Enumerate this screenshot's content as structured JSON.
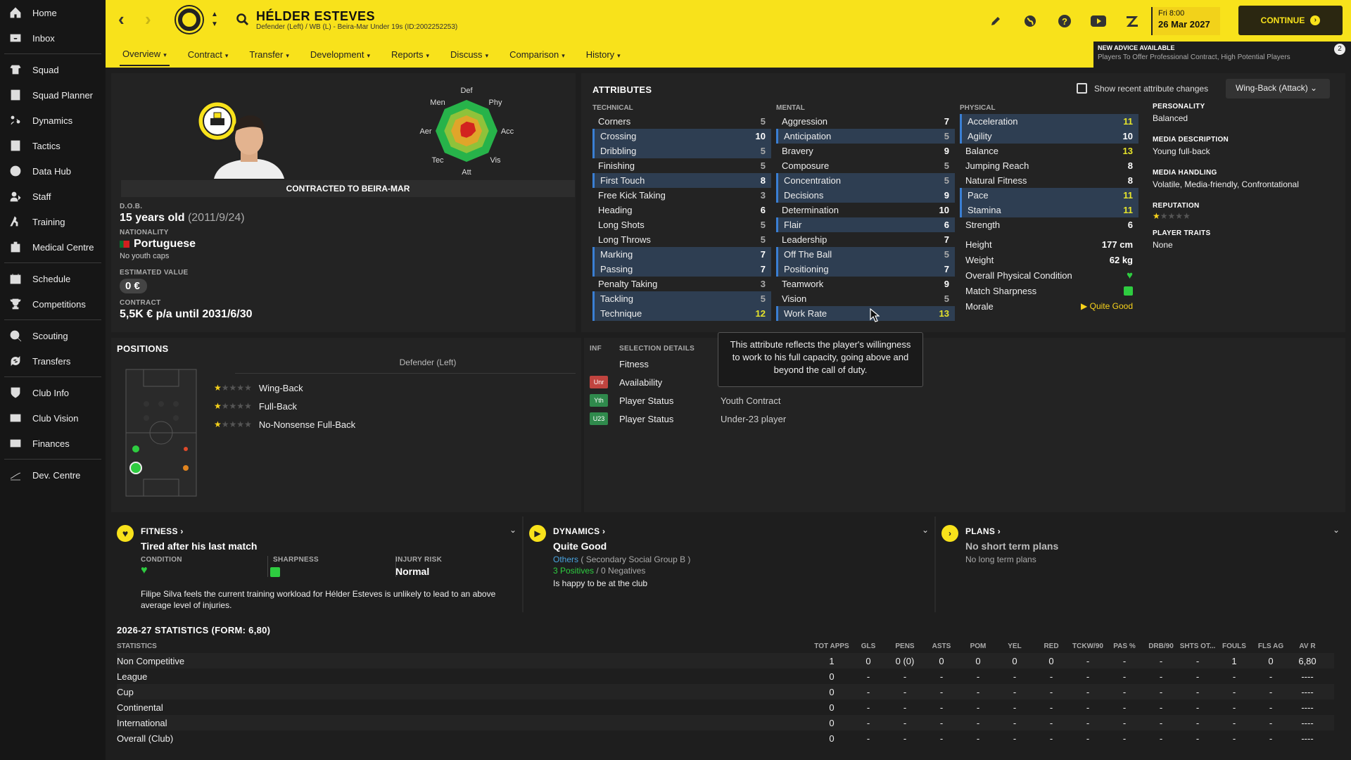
{
  "sidebar": {
    "items": [
      {
        "label": "Home",
        "icon": "home-icon"
      },
      {
        "label": "Inbox",
        "icon": "inbox-icon"
      },
      {
        "label": "Squad",
        "icon": "squad-icon"
      },
      {
        "label": "Squad Planner",
        "icon": "squad-planner-icon"
      },
      {
        "label": "Dynamics",
        "icon": "dynamics-icon"
      },
      {
        "label": "Tactics",
        "icon": "tactics-icon"
      },
      {
        "label": "Data Hub",
        "icon": "data-hub-icon"
      },
      {
        "label": "Staff",
        "icon": "staff-icon"
      },
      {
        "label": "Training",
        "icon": "training-icon"
      },
      {
        "label": "Medical Centre",
        "icon": "medical-icon"
      },
      {
        "label": "Schedule",
        "icon": "schedule-icon"
      },
      {
        "label": "Competitions",
        "icon": "trophy-icon"
      },
      {
        "label": "Scouting",
        "icon": "scouting-icon"
      },
      {
        "label": "Transfers",
        "icon": "transfers-icon"
      },
      {
        "label": "Club Info",
        "icon": "club-info-icon"
      },
      {
        "label": "Club Vision",
        "icon": "club-vision-icon"
      },
      {
        "label": "Finances",
        "icon": "finances-icon"
      },
      {
        "label": "Dev. Centre",
        "icon": "dev-centre-icon"
      }
    ]
  },
  "header": {
    "player_name": "HÉLDER ESTEVES",
    "player_sub": "Defender (Left) / WB (L) - Beira-Mar Under 19s (ID:2002252253)",
    "date_line1": "Fri 8:00",
    "date_line2": "26 Mar 2027",
    "continue_label": "CONTINUE"
  },
  "tabs": [
    {
      "label": "Overview"
    },
    {
      "label": "Contract"
    },
    {
      "label": "Transfer"
    },
    {
      "label": "Development"
    },
    {
      "label": "Reports"
    },
    {
      "label": "Discuss"
    },
    {
      "label": "Comparison"
    },
    {
      "label": "History"
    }
  ],
  "advice": {
    "title": "NEW ADVICE AVAILABLE",
    "text": "Players To Offer Professional Contract, High Potential Players",
    "count": "2"
  },
  "profile": {
    "contract_banner": "CONTRACTED TO BEIRA-MAR",
    "dob_label": "D.O.B.",
    "age": "15 years old",
    "dob": "(2011/9/24)",
    "nationality_label": "NATIONALITY",
    "nationality": "Portuguese",
    "youth_caps": "No youth caps",
    "value_label": "ESTIMATED VALUE",
    "value": "0 €",
    "contract_label": "CONTRACT",
    "contract": "5,5K € p/a until 2031/6/30"
  },
  "radar": {
    "labels": [
      "Def",
      "Phy",
      "Acc",
      "Vis",
      "Att",
      "Tec",
      "Aer",
      "Men"
    ]
  },
  "attributes": {
    "title": "ATTRIBUTES",
    "show_changes_label": "Show recent attribute changes",
    "role": "Wing-Back (Attack)",
    "technical_label": "TECHNICAL",
    "mental_label": "MENTAL",
    "physical_label": "PHYSICAL",
    "technical": [
      [
        "Corners",
        "5"
      ],
      [
        "Crossing",
        "10"
      ],
      [
        "Dribbling",
        "5"
      ],
      [
        "Finishing",
        "5"
      ],
      [
        "First Touch",
        "8"
      ],
      [
        "Free Kick Taking",
        "3"
      ],
      [
        "Heading",
        "6"
      ],
      [
        "Long Shots",
        "5"
      ],
      [
        "Long Throws",
        "5"
      ],
      [
        "Marking",
        "7"
      ],
      [
        "Passing",
        "7"
      ],
      [
        "Penalty Taking",
        "3"
      ],
      [
        "Tackling",
        "5"
      ],
      [
        "Technique",
        "12"
      ]
    ],
    "mental": [
      [
        "Aggression",
        "7"
      ],
      [
        "Anticipation",
        "5"
      ],
      [
        "Bravery",
        "9"
      ],
      [
        "Composure",
        "5"
      ],
      [
        "Concentration",
        "5"
      ],
      [
        "Decisions",
        "9"
      ],
      [
        "Determination",
        "10"
      ],
      [
        "Flair",
        "6"
      ],
      [
        "Leadership",
        "7"
      ],
      [
        "Off The Ball",
        "5"
      ],
      [
        "Positioning",
        "7"
      ],
      [
        "Teamwork",
        "9"
      ],
      [
        "Vision",
        "5"
      ],
      [
        "Work Rate",
        "13"
      ]
    ],
    "physical": [
      [
        "Acceleration",
        "11"
      ],
      [
        "Agility",
        "10"
      ],
      [
        "Balance",
        "13"
      ],
      [
        "Jumping Reach",
        "8"
      ],
      [
        "Natural Fitness",
        "8"
      ],
      [
        "Pace",
        "11"
      ],
      [
        "Stamina",
        "11"
      ],
      [
        "Strength",
        "6"
      ]
    ],
    "height_label": "Height",
    "height": "177 cm",
    "weight_label": "Weight",
    "weight": "62 kg",
    "condition_label": "Overall Physical Condition",
    "sharpness_label": "Match Sharpness",
    "morale_label": "Morale",
    "morale": "Quite Good"
  },
  "personality": {
    "personality_label": "PERSONALITY",
    "personality": "Balanced",
    "media_desc_label": "MEDIA DESCRIPTION",
    "media_desc": "Young full-back",
    "media_handling_label": "MEDIA HANDLING",
    "media_handling": "Volatile, Media-friendly, Confrontational",
    "reputation_label": "REPUTATION",
    "reputation_stars": 0.5,
    "traits_label": "PLAYER TRAITS",
    "traits": "None"
  },
  "tooltip": "This attribute reflects the player's willingness to work to his full capacity, going above and beyond the call of duty.",
  "positions": {
    "title": "POSITIONS",
    "main": "Defender (Left)",
    "list": [
      {
        "label": "Wing-Back",
        "stars": 1
      },
      {
        "label": "Full-Back",
        "stars": 1
      },
      {
        "label": "No-Nonsense Full-Back",
        "stars": 1
      }
    ]
  },
  "selection": {
    "inf_label": "INF",
    "details_label": "SELECTION DETAILS",
    "rows": [
      {
        "badge": "",
        "label": "Fitness",
        "value": ""
      },
      {
        "badge": "Unr",
        "label": "Availability",
        "value": ""
      },
      {
        "badge": "Yth",
        "label": "Player Status",
        "value": "Youth Contract"
      },
      {
        "badge": "U23",
        "label": "Player Status",
        "value": "Under-23 player"
      }
    ]
  },
  "fitness": {
    "title": "FITNESS",
    "status": "Tired after his last match",
    "condition_label": "CONDITION",
    "sharpness_label": "SHARPNESS",
    "injury_label": "INJURY RISK",
    "injury": "Normal",
    "note": "Filipe Silva feels the current training workload for Hélder Esteves is unlikely to lead to an above average level of injuries."
  },
  "dynamics": {
    "title": "DYNAMICS",
    "status": "Quite Good",
    "group": "Others",
    "group_sub": "( Secondary Social Group B )",
    "positives": "3 Positives",
    "negatives": "0 Negatives",
    "note": "Is happy to be at the club"
  },
  "plans": {
    "title": "PLANS",
    "short": "No short term plans",
    "long": "No long term plans"
  },
  "stats": {
    "title": "2026-27 STATISTICS (FORM: 6,80)",
    "col_label": "STATISTICS",
    "columns": [
      "TOT APPS",
      "GLS",
      "PENS",
      "ASTS",
      "POM",
      "YEL",
      "RED",
      "TCKW/90",
      "PAS %",
      "DRB/90",
      "SHTS OT...",
      "FOULS",
      "FLS AG",
      "AV R"
    ],
    "rows": [
      {
        "name": "Non Competitive",
        "vals": [
          "1",
          "0",
          "0 (0)",
          "0",
          "0",
          "0",
          "0",
          "-",
          "-",
          "-",
          "-",
          "1",
          "0",
          "6,80"
        ]
      },
      {
        "name": "League",
        "vals": [
          "0",
          "-",
          "-",
          "-",
          "-",
          "-",
          "-",
          "-",
          "-",
          "-",
          "-",
          "-",
          "-",
          "----"
        ]
      },
      {
        "name": "Cup",
        "vals": [
          "0",
          "-",
          "-",
          "-",
          "-",
          "-",
          "-",
          "-",
          "-",
          "-",
          "-",
          "-",
          "-",
          "----"
        ]
      },
      {
        "name": "Continental",
        "vals": [
          "0",
          "-",
          "-",
          "-",
          "-",
          "-",
          "-",
          "-",
          "-",
          "-",
          "-",
          "-",
          "-",
          "----"
        ]
      },
      {
        "name": "International",
        "vals": [
          "0",
          "-",
          "-",
          "-",
          "-",
          "-",
          "-",
          "-",
          "-",
          "-",
          "-",
          "-",
          "-",
          "----"
        ]
      },
      {
        "name": "Overall (Club)",
        "vals": [
          "0",
          "-",
          "-",
          "-",
          "-",
          "-",
          "-",
          "-",
          "-",
          "-",
          "-",
          "-",
          "-",
          "----"
        ]
      }
    ]
  },
  "colors": {
    "accent": "#f8e21b",
    "highlight": "#2e3e52",
    "good": "#2ecc40"
  }
}
